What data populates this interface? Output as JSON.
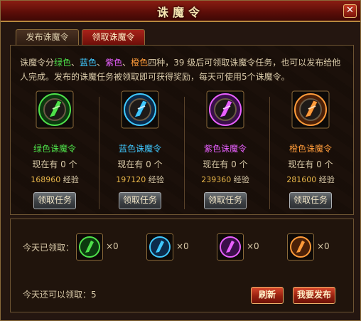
{
  "window": {
    "title": "诛魔令",
    "close_symbol": "✕"
  },
  "tabs": [
    {
      "label": "发布诛魔令",
      "active": false
    },
    {
      "label": "领取诛魔令",
      "active": true
    }
  ],
  "description": {
    "prefix": "诛魔令分",
    "green": "绿色",
    "sep1": "、",
    "blue": "蓝色",
    "sep2": "、",
    "purple": "紫色",
    "sep3": "、",
    "orange": "橙色",
    "suffix": "四种，39 级后可领取诛魔令任务，也可以发布给他人完成。发布的诛魔任务被领取即可获得奖励，每天可使用5个诛魔令。"
  },
  "cards": [
    {
      "name": "绿色诛魔令",
      "color": "#4ee04a",
      "icon": "green-token-icon",
      "owned_label": "现在有",
      "owned": "0",
      "owned_unit": "个",
      "exp_value": "168960",
      "exp_unit": "经验",
      "button": "领取任务"
    },
    {
      "name": "蓝色诛魔令",
      "color": "#3fc8ff",
      "icon": "blue-token-icon",
      "owned_label": "现在有",
      "owned": "0",
      "owned_unit": "个",
      "exp_value": "197120",
      "exp_unit": "经验",
      "button": "领取任务"
    },
    {
      "name": "紫色诛魔令",
      "color": "#e860ff",
      "icon": "purple-token-icon",
      "owned_label": "现在有",
      "owned": "0",
      "owned_unit": "个",
      "exp_value": "239360",
      "exp_unit": "经验",
      "button": "领取任务"
    },
    {
      "name": "橙色诛魔令",
      "color": "#ff9b3a",
      "icon": "orange-token-icon",
      "owned_label": "现在有",
      "owned": "0",
      "owned_unit": "个",
      "exp_value": "281600",
      "exp_unit": "经验",
      "button": "领取任务"
    }
  ],
  "today": {
    "label": "今天已领取：",
    "slots": [
      {
        "icon": "green-token-icon",
        "count": "×0",
        "color": "#4ee04a"
      },
      {
        "icon": "blue-token-icon",
        "count": "×0",
        "color": "#3fc8ff"
      },
      {
        "icon": "purple-token-icon",
        "count": "×0",
        "color": "#e860ff"
      },
      {
        "icon": "orange-token-icon",
        "count": "×0",
        "color": "#ff9b3a"
      }
    ],
    "remaining": "今天还可以领取：5"
  },
  "actions": {
    "refresh": "刷新",
    "publish": "我要发布"
  }
}
